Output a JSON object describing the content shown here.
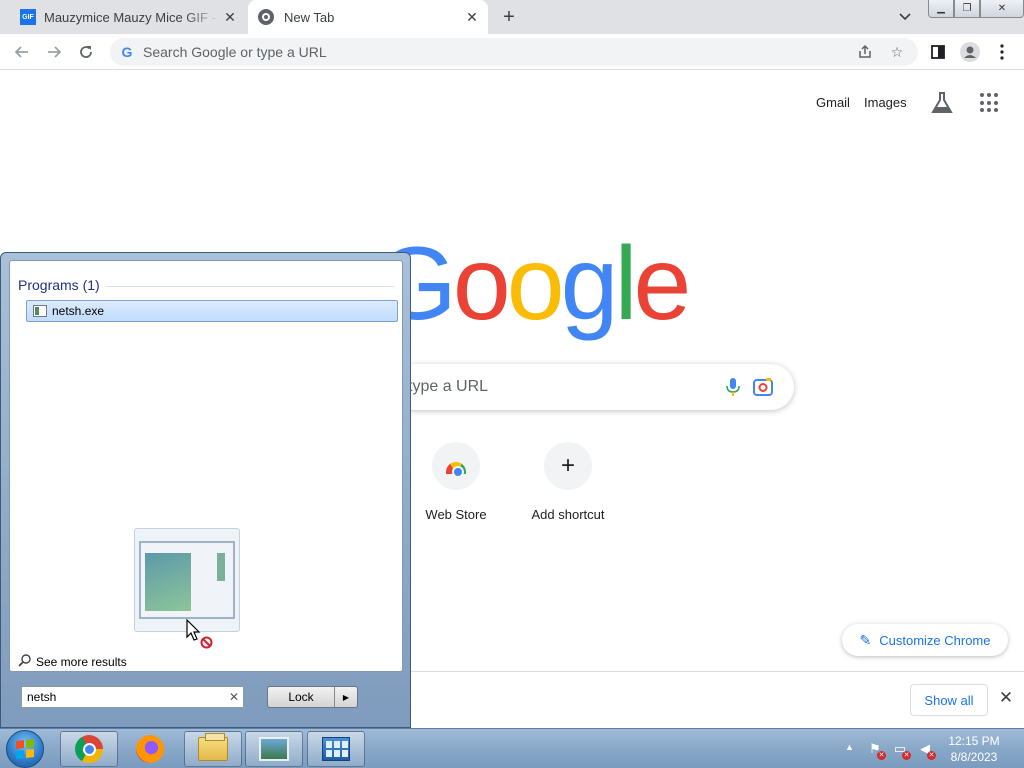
{
  "browser": {
    "tabs": [
      {
        "title": "Mauzymice Mauzy Mice GIF - Mauzy",
        "favicon": "gif-icon",
        "active": false
      },
      {
        "title": "New Tab",
        "favicon": "chrome-icon",
        "active": true
      }
    ],
    "omnibox": {
      "placeholder": "Search Google or type a URL"
    }
  },
  "ntp": {
    "top_links": {
      "gmail": "Gmail",
      "images": "Images"
    },
    "logo": "Google",
    "search_placeholder": "type a URL",
    "shortcuts": [
      {
        "label": "Web Store",
        "icon": "web-store-icon"
      },
      {
        "label": "Add shortcut",
        "icon": "plus-icon"
      }
    ],
    "customize_label": "Customize Chrome",
    "download_bar": {
      "show_all": "Show all"
    }
  },
  "start_menu": {
    "heading": "Programs (1)",
    "results": [
      {
        "label": "netsh.exe",
        "icon": "exe-icon"
      }
    ],
    "see_more": "See more results",
    "search_value": "netsh",
    "power_button": "Lock"
  },
  "taskbar": {
    "items": [
      "chrome-icon",
      "firefox-icon",
      "explorer-icon",
      "pictures-icon",
      "remote-desktop-icon"
    ],
    "clock": {
      "time": "12:15 PM",
      "date": "8/8/2023"
    }
  },
  "colors": {
    "google_blue": "#4285f4",
    "google_red": "#ea4335",
    "google_yellow": "#fbbc05",
    "google_green": "#34a853",
    "link_blue": "#1a73e8",
    "start_menu_heading": "#1e3287"
  }
}
